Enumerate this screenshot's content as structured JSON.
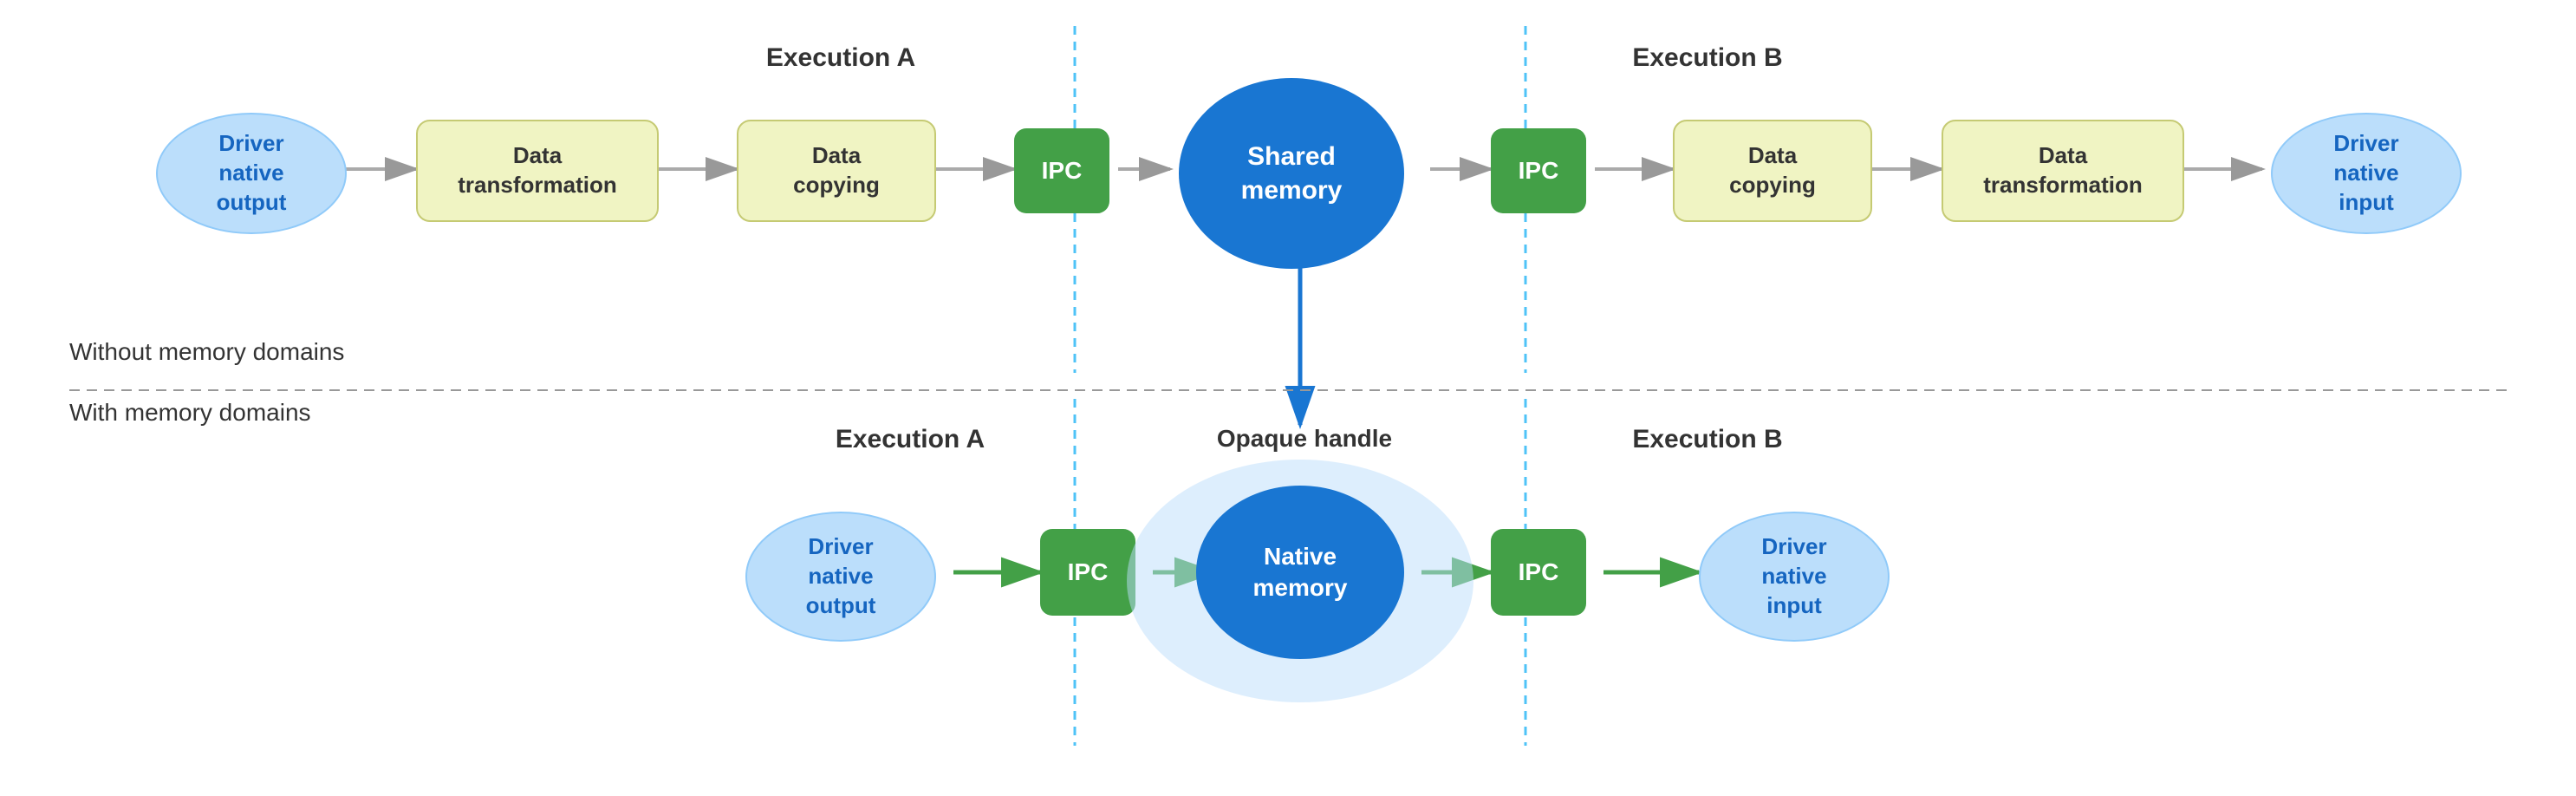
{
  "diagram": {
    "sections": {
      "without_label": "Without memory domains",
      "with_label": "With memory domains"
    },
    "execution_labels": {
      "top_a": "Execution A",
      "top_b": "Execution B",
      "bottom_a": "Execution A",
      "bottom_b": "Execution B"
    },
    "opaque_label": "Opaque handle",
    "top_row": {
      "nodes": [
        {
          "id": "driver-native-output-top",
          "label": "Driver\nnative\noutput",
          "type": "oval",
          "style": "lightblue"
        },
        {
          "id": "data-transform-top-left",
          "label": "Data\ntransformation",
          "type": "rect",
          "style": "yellow"
        },
        {
          "id": "data-copying-top-left",
          "label": "Data\ncopying",
          "type": "rect",
          "style": "yellow"
        },
        {
          "id": "ipc-top-left",
          "label": "IPC",
          "type": "rect",
          "style": "green"
        },
        {
          "id": "shared-memory",
          "label": "Shared\nmemory",
          "type": "oval",
          "style": "blue-dark"
        },
        {
          "id": "ipc-top-right",
          "label": "IPC",
          "type": "rect",
          "style": "green"
        },
        {
          "id": "data-copying-top-right",
          "label": "Data\ncopying",
          "type": "rect",
          "style": "yellow"
        },
        {
          "id": "data-transform-top-right",
          "label": "Data\ntransformation",
          "type": "rect",
          "style": "yellow"
        },
        {
          "id": "driver-native-input-top",
          "label": "Driver\nnative\ninput",
          "type": "oval",
          "style": "lightblue"
        }
      ]
    },
    "bottom_row": {
      "nodes": [
        {
          "id": "driver-native-output-bottom",
          "label": "Driver\nnative\noutput",
          "type": "oval",
          "style": "lightblue"
        },
        {
          "id": "ipc-bottom-left",
          "label": "IPC",
          "type": "rect",
          "style": "green"
        },
        {
          "id": "native-memory",
          "label": "Native\nmemory",
          "type": "oval-large",
          "style": "lightblue-large"
        },
        {
          "id": "ipc-bottom-right",
          "label": "IPC",
          "type": "rect",
          "style": "green"
        },
        {
          "id": "driver-native-input-bottom",
          "label": "Driver\nnative\ninput",
          "type": "oval",
          "style": "lightblue"
        }
      ]
    }
  }
}
